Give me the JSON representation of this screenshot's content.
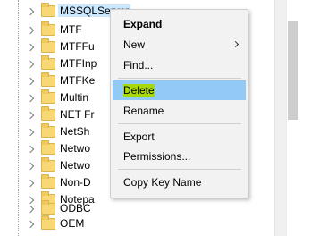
{
  "tree": {
    "items": [
      {
        "label": "MSSQLServer"
      },
      {
        "label": "MTF"
      },
      {
        "label": "MTFFu"
      },
      {
        "label": "MTFInp"
      },
      {
        "label": "MTFKe"
      },
      {
        "label": "Multin"
      },
      {
        "label": "NET Fr"
      },
      {
        "label": "NetSh"
      },
      {
        "label": "Netwo"
      },
      {
        "label": "Netwo"
      },
      {
        "label": "Non-D"
      },
      {
        "label": "Notepa"
      },
      {
        "label": "ODBC"
      },
      {
        "label": "OEM"
      }
    ]
  },
  "context_menu": {
    "expand": "Expand",
    "new": "New",
    "find": "Find...",
    "delete": "Delete",
    "rename": "Rename",
    "export": "Export",
    "permissions": "Permissions...",
    "copy_key_name": "Copy Key Name"
  },
  "colors": {
    "selected_row": "#cce8ff",
    "menu_hover": "#91c9f7",
    "highlighter_green": "#a6d80a",
    "highlighter_yellow": "#f5f24a",
    "folder": "#f8d775"
  }
}
